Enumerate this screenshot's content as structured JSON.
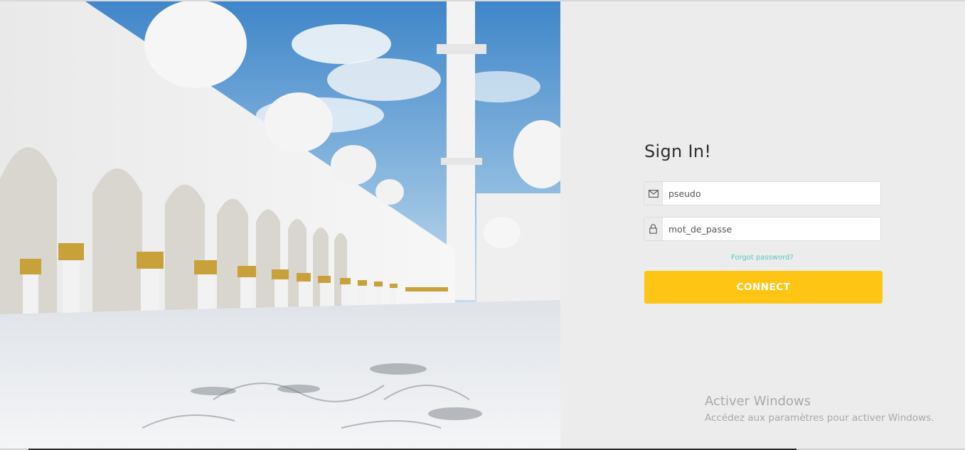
{
  "login": {
    "title": "Sign In!",
    "username": {
      "placeholder": "pseudo",
      "icon": "envelope-icon"
    },
    "password": {
      "placeholder": "mot_de_passe",
      "icon": "lock-icon"
    },
    "forgot_label": "Forgot password?",
    "connect_label": "CONNECT"
  },
  "watermark": {
    "title": "Activer Windows",
    "subtitle": "Accédez aux paramètres pour activer Windows."
  },
  "colors": {
    "accent": "#fec514",
    "link": "#5fc4c4",
    "panel_bg": "#ececec"
  },
  "hero": {
    "image": "mosque-courtyard-photo"
  }
}
